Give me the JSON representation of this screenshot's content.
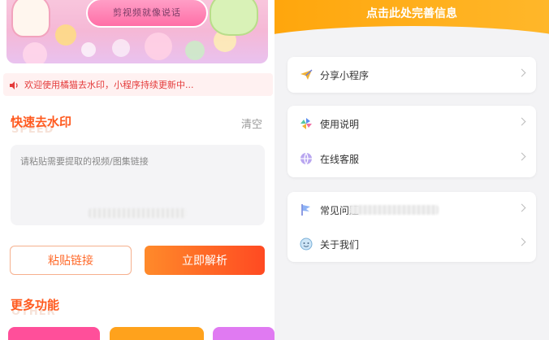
{
  "left": {
    "banner": {
      "plate_text": "剪视频就像说话"
    },
    "notice": {
      "text": "欢迎使用橘猫去水印，小程序持续更新中..."
    },
    "quick": {
      "title": "快速去水印",
      "shadow": "SPEED",
      "clear_label": "清空"
    },
    "input": {
      "placeholder": "请粘贴需要提取的视频/图集链接"
    },
    "buttons": {
      "paste": "粘贴链接",
      "parse": "立即解析"
    },
    "more": {
      "title": "更多功能",
      "shadow": "OTHER",
      "tiles": [
        "#ff4f9a",
        "#ffa21c",
        "#e07af2"
      ]
    }
  },
  "right": {
    "header": {
      "text": "点击此处完善信息"
    },
    "menu": [
      {
        "label": "分享小程序",
        "icon": "paper-plane-icon"
      },
      {
        "label": "使用说明",
        "icon": "pinwheel-icon"
      },
      {
        "label": "在线客服",
        "icon": "globe-icon"
      },
      {
        "label": "常见问题",
        "icon": "flag-icon"
      },
      {
        "label": "关于我们",
        "icon": "smiley-icon"
      }
    ]
  },
  "colors": {
    "accent": "#ff5a1f",
    "header": "#ffa60c",
    "notice": "#e43b3b"
  }
}
